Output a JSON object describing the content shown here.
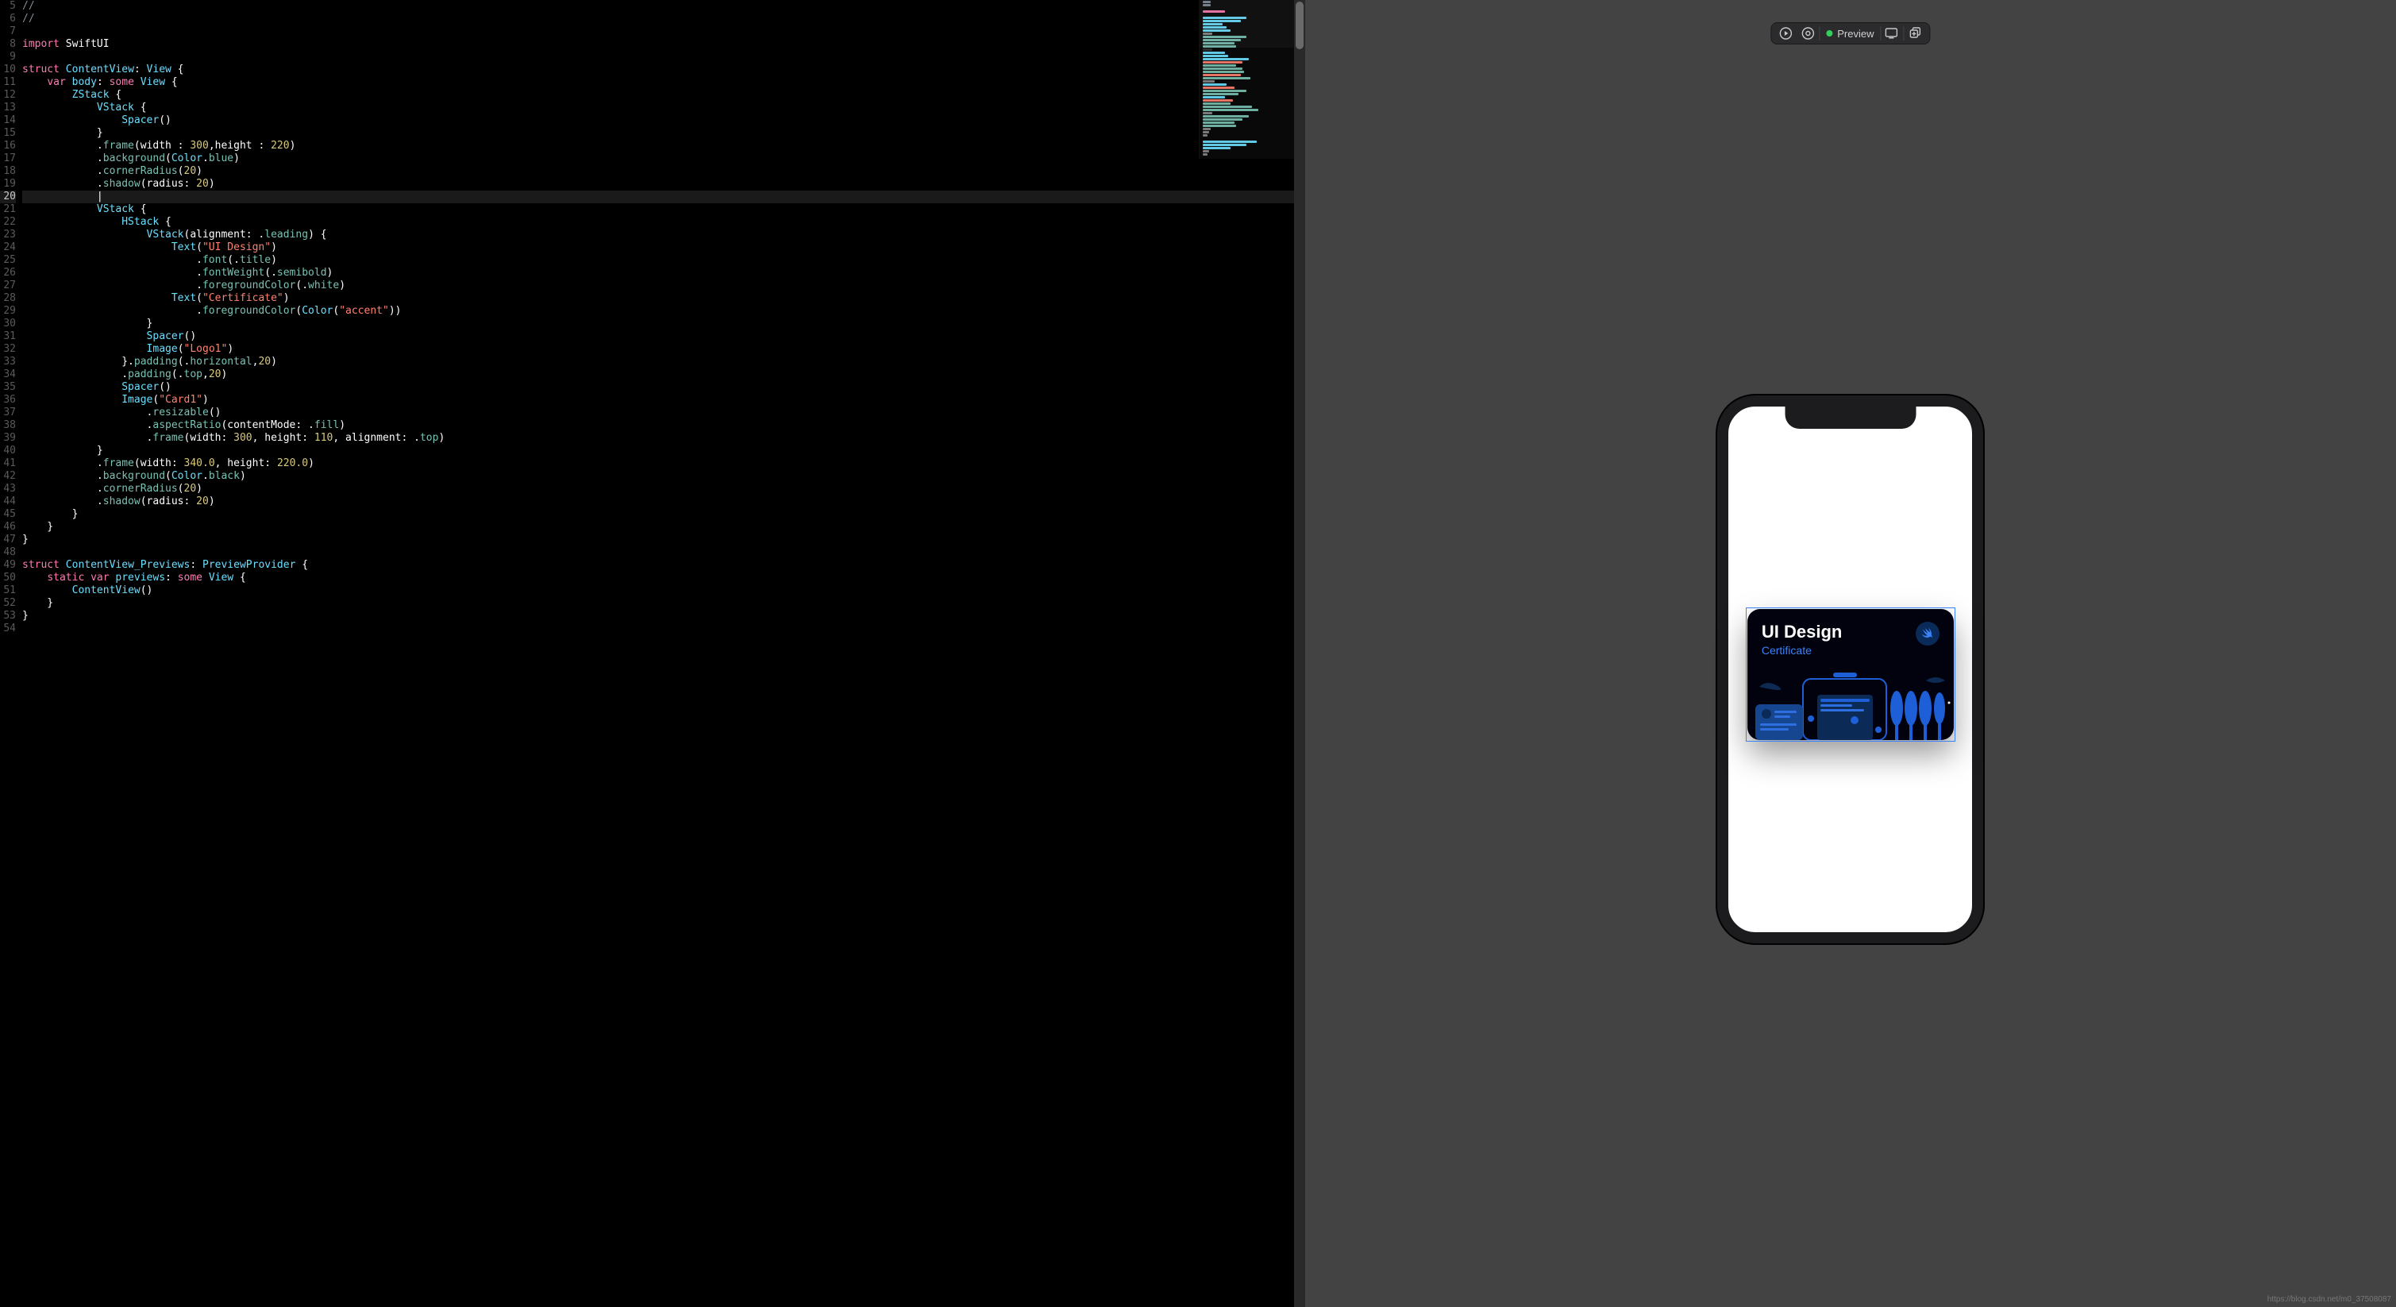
{
  "editor": {
    "current_line": 20,
    "lines": [
      {
        "n": 5,
        "tokens": [
          [
            "cmt",
            "//"
          ]
        ]
      },
      {
        "n": 6,
        "tokens": [
          [
            "cmt",
            "//"
          ]
        ]
      },
      {
        "n": 7,
        "tokens": []
      },
      {
        "n": 8,
        "tokens": [
          [
            "kw",
            "import "
          ],
          [
            "pl",
            "SwiftUI"
          ]
        ]
      },
      {
        "n": 9,
        "tokens": []
      },
      {
        "n": 10,
        "tokens": [
          [
            "kw",
            "struct "
          ],
          [
            "type",
            "ContentView"
          ],
          [
            "pl",
            ": "
          ],
          [
            "type",
            "View"
          ],
          [
            "pl",
            " {"
          ]
        ]
      },
      {
        "n": 11,
        "tokens": [
          [
            "pl",
            "    "
          ],
          [
            "kw",
            "var "
          ],
          [
            "type",
            "body"
          ],
          [
            "pl",
            ": "
          ],
          [
            "kw",
            "some "
          ],
          [
            "type",
            "View"
          ],
          [
            "pl",
            " {"
          ]
        ]
      },
      {
        "n": 12,
        "tokens": [
          [
            "pl",
            "        "
          ],
          [
            "type",
            "ZStack"
          ],
          [
            "pl",
            " {"
          ]
        ]
      },
      {
        "n": 13,
        "tokens": [
          [
            "pl",
            "            "
          ],
          [
            "type",
            "VStack"
          ],
          [
            "pl",
            " {"
          ]
        ]
      },
      {
        "n": 14,
        "tokens": [
          [
            "pl",
            "                "
          ],
          [
            "type",
            "Spacer"
          ],
          [
            "pl",
            "()"
          ]
        ]
      },
      {
        "n": 15,
        "tokens": [
          [
            "pl",
            "            }"
          ]
        ]
      },
      {
        "n": 16,
        "tokens": [
          [
            "pl",
            "            ."
          ],
          [
            "mod",
            "frame"
          ],
          [
            "pl",
            "(width : "
          ],
          [
            "num",
            "300"
          ],
          [
            "pl",
            ",height : "
          ],
          [
            "num",
            "220"
          ],
          [
            "pl",
            ")"
          ]
        ]
      },
      {
        "n": 17,
        "tokens": [
          [
            "pl",
            "            ."
          ],
          [
            "mod",
            "background"
          ],
          [
            "pl",
            "("
          ],
          [
            "type",
            "Color"
          ],
          [
            "pl",
            "."
          ],
          [
            "mod",
            "blue"
          ],
          [
            "pl",
            ")"
          ]
        ]
      },
      {
        "n": 18,
        "tokens": [
          [
            "pl",
            "            ."
          ],
          [
            "mod",
            "cornerRadius"
          ],
          [
            "pl",
            "("
          ],
          [
            "num",
            "20"
          ],
          [
            "pl",
            ")"
          ]
        ]
      },
      {
        "n": 19,
        "tokens": [
          [
            "pl",
            "            ."
          ],
          [
            "mod",
            "shadow"
          ],
          [
            "pl",
            "(radius: "
          ],
          [
            "num",
            "20"
          ],
          [
            "pl",
            ")"
          ]
        ]
      },
      {
        "n": 20,
        "tokens": [
          [
            "pl",
            "            "
          ]
        ]
      },
      {
        "n": 21,
        "tokens": [
          [
            "pl",
            "            "
          ],
          [
            "type",
            "VStack"
          ],
          [
            "pl",
            " {"
          ]
        ]
      },
      {
        "n": 22,
        "tokens": [
          [
            "pl",
            "                "
          ],
          [
            "type",
            "HStack"
          ],
          [
            "pl",
            " {"
          ]
        ]
      },
      {
        "n": 23,
        "tokens": [
          [
            "pl",
            "                    "
          ],
          [
            "type",
            "VStack"
          ],
          [
            "pl",
            "(alignment: ."
          ],
          [
            "mod",
            "leading"
          ],
          [
            "pl",
            ") {"
          ]
        ]
      },
      {
        "n": 24,
        "tokens": [
          [
            "pl",
            "                        "
          ],
          [
            "type",
            "Text"
          ],
          [
            "pl",
            "("
          ],
          [
            "str",
            "\"UI Design\""
          ],
          [
            "pl",
            ")"
          ]
        ]
      },
      {
        "n": 25,
        "tokens": [
          [
            "pl",
            "                            ."
          ],
          [
            "mod",
            "font"
          ],
          [
            "pl",
            "(."
          ],
          [
            "mod",
            "title"
          ],
          [
            "pl",
            ")"
          ]
        ]
      },
      {
        "n": 26,
        "tokens": [
          [
            "pl",
            "                            ."
          ],
          [
            "mod",
            "fontWeight"
          ],
          [
            "pl",
            "(."
          ],
          [
            "mod",
            "semibold"
          ],
          [
            "pl",
            ")"
          ]
        ]
      },
      {
        "n": 27,
        "tokens": [
          [
            "pl",
            "                            ."
          ],
          [
            "mod",
            "foregroundColor"
          ],
          [
            "pl",
            "(."
          ],
          [
            "mod",
            "white"
          ],
          [
            "pl",
            ")"
          ]
        ]
      },
      {
        "n": 28,
        "tokens": [
          [
            "pl",
            "                        "
          ],
          [
            "type",
            "Text"
          ],
          [
            "pl",
            "("
          ],
          [
            "str",
            "\"Certificate\""
          ],
          [
            "pl",
            ")"
          ]
        ]
      },
      {
        "n": 29,
        "tokens": [
          [
            "pl",
            "                            ."
          ],
          [
            "mod",
            "foregroundColor"
          ],
          [
            "pl",
            "("
          ],
          [
            "type",
            "Color"
          ],
          [
            "pl",
            "("
          ],
          [
            "str",
            "\"accent\""
          ],
          [
            "pl",
            "))"
          ]
        ]
      },
      {
        "n": 30,
        "tokens": [
          [
            "pl",
            "                    }"
          ]
        ]
      },
      {
        "n": 31,
        "tokens": [
          [
            "pl",
            "                    "
          ],
          [
            "type",
            "Spacer"
          ],
          [
            "pl",
            "()"
          ]
        ]
      },
      {
        "n": 32,
        "tokens": [
          [
            "pl",
            "                    "
          ],
          [
            "type",
            "Image"
          ],
          [
            "pl",
            "("
          ],
          [
            "str",
            "\"Logo1\""
          ],
          [
            "pl",
            ")"
          ]
        ]
      },
      {
        "n": 33,
        "tokens": [
          [
            "pl",
            "                }."
          ],
          [
            "mod",
            "padding"
          ],
          [
            "pl",
            "(."
          ],
          [
            "mod",
            "horizontal"
          ],
          [
            "pl",
            ","
          ],
          [
            "num",
            "20"
          ],
          [
            "pl",
            ")"
          ]
        ]
      },
      {
        "n": 34,
        "tokens": [
          [
            "pl",
            "                ."
          ],
          [
            "mod",
            "padding"
          ],
          [
            "pl",
            "(."
          ],
          [
            "mod",
            "top"
          ],
          [
            "pl",
            ","
          ],
          [
            "num",
            "20"
          ],
          [
            "pl",
            ")"
          ]
        ]
      },
      {
        "n": 35,
        "tokens": [
          [
            "pl",
            "                "
          ],
          [
            "type",
            "Spacer"
          ],
          [
            "pl",
            "()"
          ]
        ]
      },
      {
        "n": 36,
        "tokens": [
          [
            "pl",
            "                "
          ],
          [
            "type",
            "Image"
          ],
          [
            "pl",
            "("
          ],
          [
            "str",
            "\"Card1\""
          ],
          [
            "pl",
            ")"
          ]
        ]
      },
      {
        "n": 37,
        "tokens": [
          [
            "pl",
            "                    ."
          ],
          [
            "mod",
            "resizable"
          ],
          [
            "pl",
            "()"
          ]
        ]
      },
      {
        "n": 38,
        "tokens": [
          [
            "pl",
            "                    ."
          ],
          [
            "mod",
            "aspectRatio"
          ],
          [
            "pl",
            "(contentMode: ."
          ],
          [
            "mod",
            "fill"
          ],
          [
            "pl",
            ")"
          ]
        ]
      },
      {
        "n": 39,
        "tokens": [
          [
            "pl",
            "                    ."
          ],
          [
            "mod",
            "frame"
          ],
          [
            "pl",
            "(width: "
          ],
          [
            "num",
            "300"
          ],
          [
            "pl",
            ", height: "
          ],
          [
            "num",
            "110"
          ],
          [
            "pl",
            ", alignment: ."
          ],
          [
            "mod",
            "top"
          ],
          [
            "pl",
            ")"
          ]
        ]
      },
      {
        "n": 40,
        "tokens": [
          [
            "pl",
            "            }"
          ]
        ]
      },
      {
        "n": 41,
        "tokens": [
          [
            "pl",
            "            ."
          ],
          [
            "mod",
            "frame"
          ],
          [
            "pl",
            "(width: "
          ],
          [
            "num",
            "340.0"
          ],
          [
            "pl",
            ", height: "
          ],
          [
            "num",
            "220.0"
          ],
          [
            "pl",
            ")"
          ]
        ]
      },
      {
        "n": 42,
        "tokens": [
          [
            "pl",
            "            ."
          ],
          [
            "mod",
            "background"
          ],
          [
            "pl",
            "("
          ],
          [
            "type",
            "Color"
          ],
          [
            "pl",
            "."
          ],
          [
            "mod",
            "black"
          ],
          [
            "pl",
            ")"
          ]
        ]
      },
      {
        "n": 43,
        "tokens": [
          [
            "pl",
            "            ."
          ],
          [
            "mod",
            "cornerRadius"
          ],
          [
            "pl",
            "("
          ],
          [
            "num",
            "20"
          ],
          [
            "pl",
            ")"
          ]
        ]
      },
      {
        "n": 44,
        "tokens": [
          [
            "pl",
            "            ."
          ],
          [
            "mod",
            "shadow"
          ],
          [
            "pl",
            "(radius: "
          ],
          [
            "num",
            "20"
          ],
          [
            "pl",
            ")"
          ]
        ]
      },
      {
        "n": 45,
        "tokens": [
          [
            "pl",
            "        }"
          ]
        ]
      },
      {
        "n": 46,
        "tokens": [
          [
            "pl",
            "    }"
          ]
        ]
      },
      {
        "n": 47,
        "tokens": [
          [
            "pl",
            "}"
          ]
        ]
      },
      {
        "n": 48,
        "tokens": []
      },
      {
        "n": 49,
        "tokens": [
          [
            "kw",
            "struct "
          ],
          [
            "type",
            "ContentView_Previews"
          ],
          [
            "pl",
            ": "
          ],
          [
            "type",
            "PreviewProvider"
          ],
          [
            "pl",
            " {"
          ]
        ]
      },
      {
        "n": 50,
        "tokens": [
          [
            "pl",
            "    "
          ],
          [
            "kw",
            "static var "
          ],
          [
            "type",
            "previews"
          ],
          [
            "pl",
            ": "
          ],
          [
            "kw",
            "some "
          ],
          [
            "type",
            "View"
          ],
          [
            "pl",
            " {"
          ]
        ]
      },
      {
        "n": 51,
        "tokens": [
          [
            "pl",
            "        "
          ],
          [
            "type",
            "ContentView"
          ],
          [
            "pl",
            "()"
          ]
        ]
      },
      {
        "n": 52,
        "tokens": [
          [
            "pl",
            "    }"
          ]
        ]
      },
      {
        "n": 53,
        "tokens": [
          [
            "pl",
            "}"
          ]
        ]
      },
      {
        "n": 54,
        "tokens": []
      }
    ]
  },
  "preview_toolbar": {
    "status_label": "Preview"
  },
  "card": {
    "title": "UI Design",
    "subtitle": "Certificate"
  },
  "watermark": "https://blog.csdn.net/m0_37508087",
  "minimap_rows": [
    {
      "w": 10,
      "c": "#7f8c98"
    },
    {
      "w": 10,
      "c": "#7f8c98"
    },
    {
      "w": 0,
      "c": ""
    },
    {
      "w": 28,
      "c": "#ff7ab2"
    },
    {
      "w": 0,
      "c": ""
    },
    {
      "w": 55,
      "c": "#6bdfff"
    },
    {
      "w": 48,
      "c": "#6bdfff"
    },
    {
      "w": 25,
      "c": "#6bdfff"
    },
    {
      "w": 30,
      "c": "#6bdfff"
    },
    {
      "w": 35,
      "c": "#6bdfff"
    },
    {
      "w": 12,
      "c": "#888"
    },
    {
      "w": 55,
      "c": "#78c2b3"
    },
    {
      "w": 48,
      "c": "#78c2b3"
    },
    {
      "w": 40,
      "c": "#78c2b3"
    },
    {
      "w": 42,
      "c": "#78c2b3"
    },
    {
      "w": 12,
      "c": "#333"
    },
    {
      "w": 28,
      "c": "#6bdfff"
    },
    {
      "w": 32,
      "c": "#6bdfff"
    },
    {
      "w": 58,
      "c": "#6bdfff"
    },
    {
      "w": 50,
      "c": "#ff8170"
    },
    {
      "w": 42,
      "c": "#78c2b3"
    },
    {
      "w": 50,
      "c": "#78c2b3"
    },
    {
      "w": 52,
      "c": "#78c2b3"
    },
    {
      "w": 48,
      "c": "#ff8170"
    },
    {
      "w": 60,
      "c": "#78c2b3"
    },
    {
      "w": 15,
      "c": "#888"
    },
    {
      "w": 30,
      "c": "#6bdfff"
    },
    {
      "w": 40,
      "c": "#ff8170"
    },
    {
      "w": 55,
      "c": "#78c2b3"
    },
    {
      "w": 45,
      "c": "#78c2b3"
    },
    {
      "w": 28,
      "c": "#6bdfff"
    },
    {
      "w": 38,
      "c": "#ff8170"
    },
    {
      "w": 35,
      "c": "#78c2b3"
    },
    {
      "w": 62,
      "c": "#78c2b3"
    },
    {
      "w": 70,
      "c": "#78c2b3"
    },
    {
      "w": 12,
      "c": "#888"
    },
    {
      "w": 58,
      "c": "#78c2b3"
    },
    {
      "w": 50,
      "c": "#78c2b3"
    },
    {
      "w": 40,
      "c": "#78c2b3"
    },
    {
      "w": 42,
      "c": "#78c2b3"
    },
    {
      "w": 10,
      "c": "#888"
    },
    {
      "w": 8,
      "c": "#888"
    },
    {
      "w": 6,
      "c": "#888"
    },
    {
      "w": 0,
      "c": ""
    },
    {
      "w": 68,
      "c": "#6bdfff"
    },
    {
      "w": 55,
      "c": "#6bdfff"
    },
    {
      "w": 35,
      "c": "#6bdfff"
    },
    {
      "w": 8,
      "c": "#888"
    },
    {
      "w": 6,
      "c": "#888"
    }
  ]
}
